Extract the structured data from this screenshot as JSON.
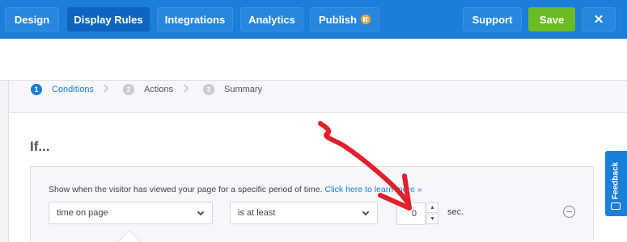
{
  "toolbar": {
    "tabs": [
      {
        "label": "Design"
      },
      {
        "label": "Display Rules"
      },
      {
        "label": "Integrations"
      },
      {
        "label": "Analytics"
      },
      {
        "label": "Publish"
      }
    ],
    "support_label": "Support",
    "save_label": "Save",
    "close_label": "✕",
    "active_tab": "Display Rules"
  },
  "steps": [
    {
      "number": "1",
      "label": "Conditions"
    },
    {
      "number": "2",
      "label": "Actions"
    },
    {
      "number": "3",
      "label": "Summary"
    }
  ],
  "rule": {
    "heading": "If...",
    "description": "Show when the visitor has viewed your page for a specific period of time.",
    "link_text": "Click here to learn more »",
    "condition_select": "time on page",
    "operator_select": "is at least",
    "value": "0",
    "unit": "sec."
  },
  "feedback_label": "Feedback",
  "colors": {
    "toolbar": "#1b7ed8",
    "active_tab": "#0d66bd",
    "save": "#6abb24",
    "publish_badge": "#f2a53a",
    "annotation_arrow": "#e0202a"
  },
  "icons": [
    "pause-icon",
    "close-icon",
    "chevron-right-icon",
    "chevron-down-icon",
    "spinner-up-icon",
    "spinner-down-icon",
    "minus-circle-icon",
    "feedback-icon"
  ]
}
